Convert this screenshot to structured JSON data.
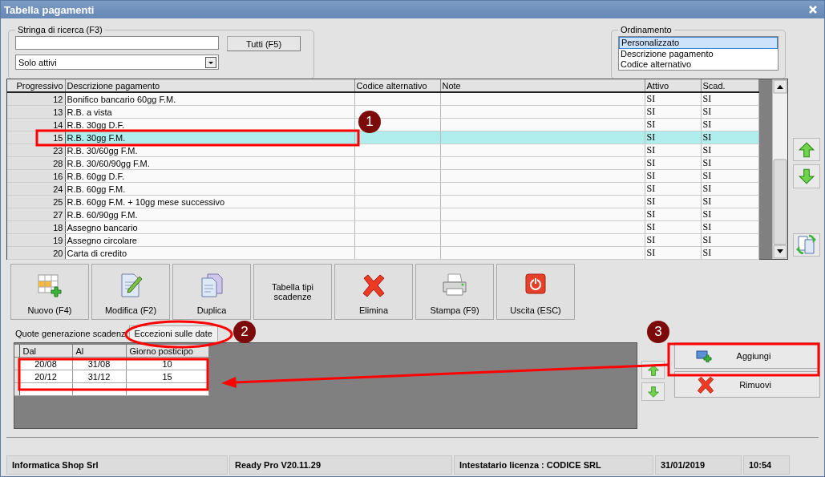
{
  "window": {
    "title": "Tabella pagamenti"
  },
  "search": {
    "group_label": "Stringa di ricerca (F3)",
    "filter": "Solo attivi",
    "all_button": "Tutti (F5)"
  },
  "ordering": {
    "label": "Ordinamento",
    "options": [
      {
        "label": "Personalizzato",
        "selected": true
      },
      {
        "label": "Descrizione pagamento",
        "selected": false
      },
      {
        "label": "Codice alternativo",
        "selected": false
      }
    ]
  },
  "table": {
    "columns": [
      "Progressivo",
      "Descrizione pagamento",
      "Codice alternativo",
      "Note",
      "Attivo",
      "Scad."
    ],
    "rows": [
      {
        "progressivo": "12",
        "descrizione": "Bonifico bancario 60gg F.M.",
        "attivo": "SI",
        "scad": "SI",
        "selected": false
      },
      {
        "progressivo": "13",
        "descrizione": "R.B. a vista",
        "attivo": "SI",
        "scad": "SI",
        "selected": false
      },
      {
        "progressivo": "14",
        "descrizione": "R.B. 30gg D.F.",
        "attivo": "SI",
        "scad": "SI",
        "selected": false
      },
      {
        "progressivo": "15",
        "descrizione": "R.B. 30gg F.M.",
        "attivo": "SI",
        "scad": "SI",
        "selected": true
      },
      {
        "progressivo": "23",
        "descrizione": "R.B. 30/60gg F.M.",
        "attivo": "SI",
        "scad": "SI",
        "selected": false
      },
      {
        "progressivo": "28",
        "descrizione": "R.B. 30/60/90gg F.M.",
        "attivo": "SI",
        "scad": "SI",
        "selected": false
      },
      {
        "progressivo": "16",
        "descrizione": "R.B. 60gg D.F.",
        "attivo": "SI",
        "scad": "SI",
        "selected": false
      },
      {
        "progressivo": "24",
        "descrizione": "R.B. 60gg F.M.",
        "attivo": "SI",
        "scad": "SI",
        "selected": false
      },
      {
        "progressivo": "25",
        "descrizione": "R.B. 60gg F.M. + 10gg mese successivo",
        "attivo": "SI",
        "scad": "SI",
        "selected": false
      },
      {
        "progressivo": "27",
        "descrizione": "R.B. 60/90gg F.M.",
        "attivo": "SI",
        "scad": "SI",
        "selected": false
      },
      {
        "progressivo": "18",
        "descrizione": "Assegno bancario",
        "attivo": "SI",
        "scad": "SI",
        "selected": false
      },
      {
        "progressivo": "19",
        "descrizione": "Assegno circolare",
        "attivo": "SI",
        "scad": "SI",
        "selected": false
      },
      {
        "progressivo": "20",
        "descrizione": "Carta di credito",
        "attivo": "SI",
        "scad": "SI",
        "selected": false
      }
    ]
  },
  "toolbar": [
    {
      "label": "Nuovo (F4)",
      "kind": "new"
    },
    {
      "label": "Modifica (F2)",
      "kind": "edit"
    },
    {
      "label": "Duplica",
      "kind": "duplicate"
    },
    {
      "label": "Tabella tipi scadenze",
      "kind": "text"
    },
    {
      "label": "Elimina",
      "kind": "delete"
    },
    {
      "label": "Stampa (F9)",
      "kind": "print"
    },
    {
      "label": "Uscita (ESC)",
      "kind": "exit"
    }
  ],
  "tabs": [
    {
      "label": "Quote generazione scadenz",
      "selected": false
    },
    {
      "label": "Eccezioni sulle date",
      "selected": true
    }
  ],
  "exceptions": {
    "columns": [
      "Dal",
      "Al",
      "Giorno posticipo"
    ],
    "rows": [
      [
        "20/08",
        "31/08",
        "10"
      ],
      [
        "20/12",
        "31/12",
        "15"
      ]
    ]
  },
  "actions": [
    {
      "label": "Aggiungi",
      "kind": "add"
    },
    {
      "label": "Rimuovi",
      "kind": "remove"
    }
  ],
  "status_bar": [
    "Informatica Shop Srl",
    "Ready Pro V20.11.29",
    "Intestatario licenza : CODICE SRL",
    "31/01/2019",
    "10:54"
  ],
  "annotations": [
    {
      "number": "1"
    },
    {
      "number": "2"
    },
    {
      "number": "3"
    }
  ]
}
